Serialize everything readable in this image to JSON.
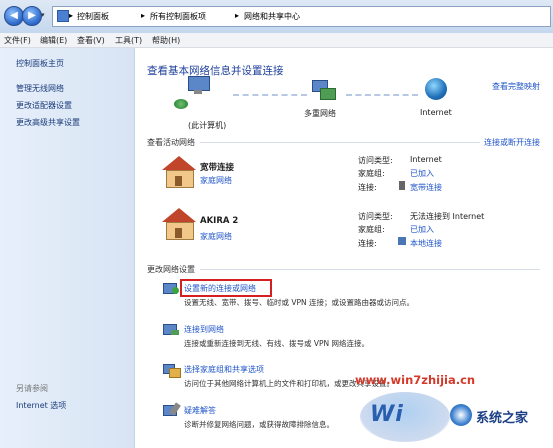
{
  "address": {
    "segments": [
      "控制面板",
      "所有控制面板项",
      "网络和共享中心"
    ],
    "sep": "▸"
  },
  "menu": [
    "文件(F)",
    "编辑(E)",
    "查看(V)",
    "工具(T)",
    "帮助(H)"
  ],
  "sidebar": {
    "home": "控制面板主页",
    "items": [
      "管理无线网络",
      "更改适配器设置",
      "更改高级共享设置"
    ],
    "see_also": "另请参阅",
    "see_also_items": [
      "Internet 选项"
    ]
  },
  "main": {
    "title": "查看基本网络信息并设置连接",
    "full_map": "查看完整映射",
    "map": {
      "computer": "(此计算机)",
      "network": "多重网络",
      "internet": "Internet"
    },
    "active_header": "查看活动网络",
    "connect_link": "连接或断开连接",
    "networks": [
      {
        "name": "宽带连接",
        "type": "家庭网络",
        "access_label": "访问类型:",
        "access": "Internet",
        "homegroup_label": "家庭组:",
        "homegroup": "已加入",
        "conn_label": "连接:",
        "conn": "宽带连接"
      },
      {
        "name": "AKIRA  2",
        "type": "家庭网络",
        "access_label": "访问类型:",
        "access": "无法连接到 Internet",
        "homegroup_label": "家庭组:",
        "homegroup": "已加入",
        "conn_label": "连接:",
        "conn": "本地连接"
      }
    ],
    "change_header": "更改网络设置",
    "tasks": [
      {
        "title": "设置新的连接或网络",
        "desc": "设置无线、宽带、拨号、临时或 VPN 连接；或设置路由器或访问点。"
      },
      {
        "title": "连接到网络",
        "desc": "连接或重新连接到无线、有线、拨号或 VPN 网络连接。"
      },
      {
        "title": "选择家庭组和共享选项",
        "desc": "访问位于其他网络计算机上的文件和打印机，或更改共享设置。"
      },
      {
        "title": "疑难解答",
        "desc": "诊断并修复网络问题，或获得故障排除信息。"
      }
    ]
  },
  "watermark": {
    "url": "www.win7zhijia.cn",
    "brand": "系统之家"
  },
  "colors": {
    "highlight_box": "#d42020",
    "link": "#1f55c8",
    "title": "#1e3f9b"
  }
}
